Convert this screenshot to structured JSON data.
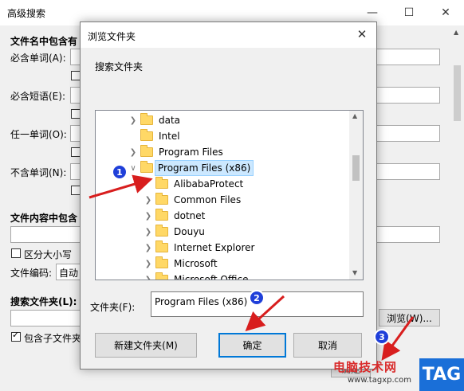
{
  "background_window": {
    "title": "高级搜索",
    "filename_section": "文件名中包含有",
    "must_words_label": "必含单词(A):",
    "must_phrase_label": "必含短语(E):",
    "any_word_label": "任一单词(O):",
    "no_word_label": "不含单词(N):",
    "content_section": "文件内容中包含",
    "case_sensitive_label": "区分大小写",
    "encoding_label": "文件编码:",
    "encoding_value": "自动",
    "search_folder_section": "搜索文件夹(L):",
    "browse_button": "浏览(W)...",
    "include_subfolders_label": "包含子文件夹",
    "confirm_partial": "确定"
  },
  "dialog": {
    "title": "浏览文件夹",
    "prompt": "搜索文件夹",
    "tree": [
      {
        "label": "data",
        "level": 0,
        "expandable": true
      },
      {
        "label": "Intel",
        "level": 0,
        "expandable": false
      },
      {
        "label": "Program Files",
        "level": 0,
        "expandable": true
      },
      {
        "label": "Program Files (x86)",
        "level": 0,
        "expandable": true,
        "expanded": true,
        "selected": true
      },
      {
        "label": "AlibabaProtect",
        "level": 1,
        "expandable": false
      },
      {
        "label": "Common Files",
        "level": 1,
        "expandable": true
      },
      {
        "label": "dotnet",
        "level": 1,
        "expandable": true
      },
      {
        "label": "Douyu",
        "level": 1,
        "expandable": true
      },
      {
        "label": "Internet Explorer",
        "level": 1,
        "expandable": true
      },
      {
        "label": "Microsoft",
        "level": 1,
        "expandable": true
      },
      {
        "label": "Microsoft Office",
        "level": 1,
        "expandable": true
      }
    ],
    "folder_label": "文件夹(F):",
    "folder_value": "Program Files (x86)",
    "new_folder_button": "新建文件夹(M)",
    "ok_button": "确定",
    "cancel_button": "取消"
  },
  "annotations": [
    "1",
    "2",
    "3"
  ],
  "watermark": {
    "text": "电脑技术网",
    "url": "www.tagxp.com",
    "tag": "TAG"
  },
  "colors": {
    "annotation_badge": "#1f3fd9",
    "annotation_arrow": "#d81e1e",
    "selection_bg": "#cce8ff",
    "folder_yellow": "#ffd866"
  }
}
